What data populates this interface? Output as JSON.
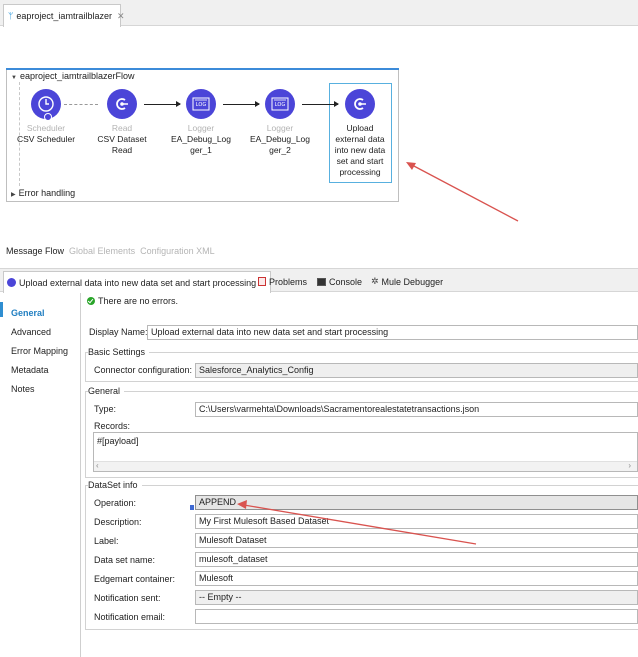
{
  "editor": {
    "tab_title": "eaproject_iamtrailblazer",
    "tab_close": "✕"
  },
  "flow": {
    "title": "eaproject_iamtrailblazerFlow",
    "error_handling": "Error handling",
    "nodes": [
      {
        "type": "Scheduler",
        "label_lines": [
          "CSV Scheduler"
        ],
        "icon": "clock-icon"
      },
      {
        "type": "Read",
        "label_lines": [
          "CSV Dataset",
          "Read"
        ],
        "icon": "connector-icon"
      },
      {
        "type": "Logger",
        "label_lines": [
          "EA_Debug_Log",
          "ger_1"
        ],
        "icon": "logger-icon"
      },
      {
        "type": "Logger",
        "label_lines": [
          "EA_Debug_Log",
          "ger_2"
        ],
        "icon": "logger-icon"
      },
      {
        "type": "",
        "label_lines": [
          "Upload",
          "external data",
          "into new data",
          "set and start",
          "processing"
        ],
        "icon": "connector-icon"
      }
    ]
  },
  "view_tabs": {
    "message_flow": "Message Flow",
    "global_elements": "Global Elements",
    "configuration_xml": "Configuration XML"
  },
  "panel_tabs": {
    "properties": "Upload external data into new data set and start processing",
    "problems": "Problems",
    "console": "Console",
    "mule_debugger": "Mule Debugger"
  },
  "nav": {
    "general": "General",
    "advanced": "Advanced",
    "error_mapping": "Error Mapping",
    "metadata": "Metadata",
    "notes": "Notes"
  },
  "form": {
    "status": "There are no errors.",
    "display_name_label": "Display Name:",
    "display_name_value": "Upload external data into new data set and start processing",
    "basic_settings_title": "Basic Settings",
    "connector_config_label": "Connector configuration:",
    "connector_config_value": "Salesforce_Analytics_Config",
    "general_title": "General",
    "type_label": "Type:",
    "type_value": "C:\\Users\\varmehta\\Downloads\\Sacramentorealestatetransactions.json",
    "records_label": "Records:",
    "records_value": "#[payload]",
    "dataset_info_title": "DataSet info",
    "operation_label": "Operation:",
    "operation_value": "APPEND",
    "description_label": "Description:",
    "description_value": "My First Mulesoft Based Dataset",
    "label_label": "Label:",
    "label_value": "Mulesoft Dataset",
    "dataset_name_label": "Data set name:",
    "dataset_name_value": "mulesoft_dataset",
    "edgemart_label": "Edgemart container:",
    "edgemart_value": "Mulesoft",
    "notification_sent_label": "Notification sent:",
    "notification_sent_value": "-- Empty --",
    "notification_email_label": "Notification email:",
    "notification_email_value": ""
  },
  "colors": {
    "accent": "#3c8bd9",
    "node_fill": "#4b45d8",
    "annotation_arrow": "#d9534f"
  }
}
